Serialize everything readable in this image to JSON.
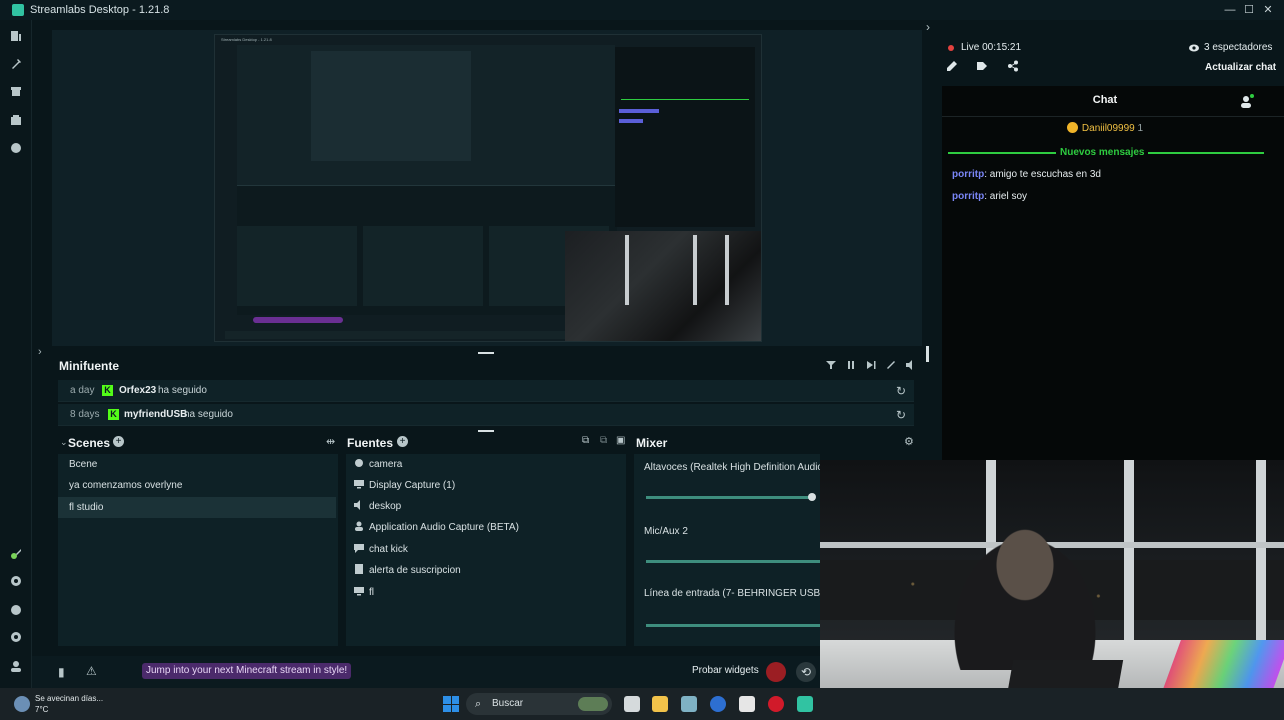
{
  "window": {
    "title": "Streamlabs Desktop - 1.21.8",
    "minimize": "—",
    "maximize": "☐",
    "close": "✕"
  },
  "sidebar": {
    "top_icons": [
      "editor-icon",
      "themes-icon",
      "store-icon",
      "layout-icon",
      "apps-icon"
    ],
    "bottom_icons": [
      "highlighter-icon",
      "studio-mode-icon",
      "help-icon",
      "settings-icon",
      "profile-icon"
    ]
  },
  "minifuente": {
    "title": "Minifuente",
    "events": [
      {
        "ago": "a day",
        "user": "Orfex23",
        "action": "ha seguido"
      },
      {
        "ago": "8 days",
        "user": "myfriendUSB",
        "action": "ha seguido"
      }
    ]
  },
  "scenes": {
    "title": "Scenes",
    "items": [
      {
        "label": "Bcene"
      },
      {
        "label": "ya comenzamos overlyne"
      },
      {
        "label": "fl studio",
        "active": true
      }
    ]
  },
  "sources": {
    "title": "Fuentes",
    "items": [
      {
        "label": "camera",
        "icon": "camera-icon"
      },
      {
        "label": "Display Capture (1)",
        "icon": "monitor-icon"
      },
      {
        "label": "deskop",
        "icon": "speaker-icon"
      },
      {
        "label": "Application Audio Capture (BETA)",
        "icon": "user-audio-icon"
      },
      {
        "label": "chat kick",
        "icon": "chat-icon"
      },
      {
        "label": "alerta de suscripcion",
        "icon": "alert-icon"
      },
      {
        "label": "fl",
        "icon": "monitor-icon"
      }
    ]
  },
  "mixer": {
    "title": "Mixer",
    "channels": [
      {
        "label": "Altavoces (Realtek High Definition Audio)",
        "level": 0.95
      },
      {
        "label": "Mic/Aux 2",
        "level": 1.0
      },
      {
        "label": "Línea de entrada (7- BEHRINGER USB WDI",
        "level": 1.0
      }
    ]
  },
  "bottombar": {
    "promo": "Jump into your next Minecraft stream in style!",
    "test_widgets": "Probar widgets"
  },
  "stream": {
    "live": "Live 00:15:21",
    "viewers": "3 espectadores",
    "refresh_chat": "Actualizar chat"
  },
  "chat": {
    "title": "Chat",
    "pinned_user": "Daniil09999",
    "pinned_count": "1",
    "new_messages": "Nuevos mensajes",
    "messages": [
      {
        "user": "porritp",
        "text": ": amigo te escuchas en 3d"
      },
      {
        "user": "porritp",
        "text": ": ariel soy"
      }
    ]
  },
  "taskbar": {
    "weather_line1": "Se avecinan días...",
    "weather_line2": "7°C",
    "search": "Buscar"
  },
  "colors": {
    "accent_green": "#2ecc40",
    "kick_green": "#53fc18",
    "live_red": "#e4423f",
    "chat_user": "#7a86f7",
    "background": "#09161a"
  }
}
